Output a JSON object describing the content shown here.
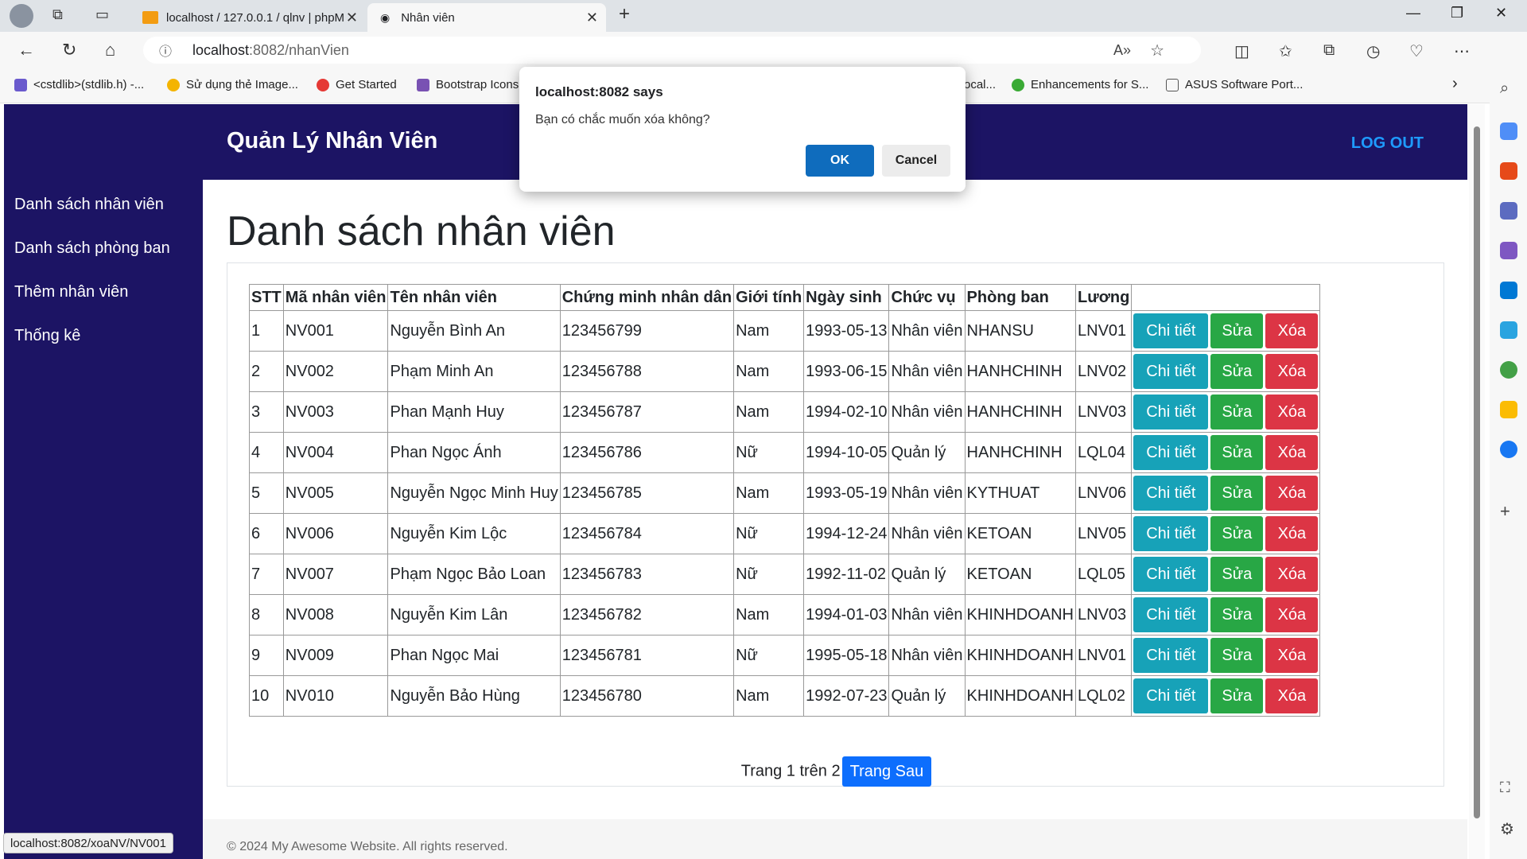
{
  "browser": {
    "tabs": [
      {
        "title": "localhost / 127.0.0.1 / qlnv | phpM"
      },
      {
        "title": "Nhân viên"
      }
    ],
    "url_host": "localhost",
    "url_path": ":8082/nhanVien",
    "bookmarks": [
      "<cstdlib>(stdlib.h) -...",
      "Sử dụng thẻ Image...",
      "Get Started",
      "Bootstrap Icons",
      "ocal...",
      "Enhancements for S...",
      "ASUS Software Port..."
    ],
    "status_url": "localhost:8082/xoaNV/NV001"
  },
  "app": {
    "brand": "Quản Lý Nhân Viên",
    "logout": "LOG OUT",
    "sidebar": [
      "Danh sách nhân viên",
      "Danh sách phòng ban",
      "Thêm nhân viên",
      "Thống kê"
    ],
    "page_title": "Danh sách nhân viên"
  },
  "table": {
    "headers": [
      "STT",
      "Mã nhân viên",
      "Tên nhân viên",
      "Chứng minh nhân dân",
      "Giới tính",
      "Ngày sinh",
      "Chức vụ",
      "Phòng ban",
      "Lương",
      ""
    ],
    "actions": {
      "detail": "Chi tiết",
      "edit": "Sửa",
      "delete": "Xóa"
    },
    "rows": [
      [
        "1",
        "NV001",
        "Nguyễn Bình An",
        "123456799",
        "Nam",
        "1993-05-13",
        "Nhân viên",
        "NHANSU",
        "LNV01"
      ],
      [
        "2",
        "NV002",
        "Phạm Minh An",
        "123456788",
        "Nam",
        "1993-06-15",
        "Nhân viên",
        "HANHCHINH",
        "LNV02"
      ],
      [
        "3",
        "NV003",
        "Phan Mạnh Huy",
        "123456787",
        "Nam",
        "1994-02-10",
        "Nhân viên",
        "HANHCHINH",
        "LNV03"
      ],
      [
        "4",
        "NV004",
        "Phan Ngọc Ánh",
        "123456786",
        "Nữ",
        "1994-10-05",
        "Quản lý",
        "HANHCHINH",
        "LQL04"
      ],
      [
        "5",
        "NV005",
        "Nguyễn Ngọc Minh Huy",
        "123456785",
        "Nam",
        "1993-05-19",
        "Nhân viên",
        "KYTHUAT",
        "LNV06"
      ],
      [
        "6",
        "NV006",
        "Nguyễn Kim Lộc",
        "123456784",
        "Nữ",
        "1994-12-24",
        "Nhân viên",
        "KETOAN",
        "LNV05"
      ],
      [
        "7",
        "NV007",
        "Phạm Ngọc Bảo Loan",
        "123456783",
        "Nữ",
        "1992-11-02",
        "Quản lý",
        "KETOAN",
        "LQL05"
      ],
      [
        "8",
        "NV008",
        "Nguyễn Kim Lân",
        "123456782",
        "Nam",
        "1994-01-03",
        "Nhân viên",
        "KHINHDOANH",
        "LNV03"
      ],
      [
        "9",
        "NV009",
        "Phan Ngọc Mai",
        "123456781",
        "Nữ",
        "1995-05-18",
        "Nhân viên",
        "KHINHDOANH",
        "LNV01"
      ],
      [
        "10",
        "NV010",
        "Nguyễn Bảo Hùng",
        "123456780",
        "Nam",
        "1992-07-23",
        "Quản lý",
        "KHINHDOANH",
        "LQL02"
      ]
    ]
  },
  "pagination": {
    "text": "Trang 1 trên 2",
    "next": "Trang Sau"
  },
  "footer": "© 2024 My Awesome Website. All rights reserved.",
  "dialog": {
    "title": "localhost:8082 says",
    "message": "Bạn có chắc muốn xóa không?",
    "ok": "OK",
    "cancel": "Cancel"
  }
}
